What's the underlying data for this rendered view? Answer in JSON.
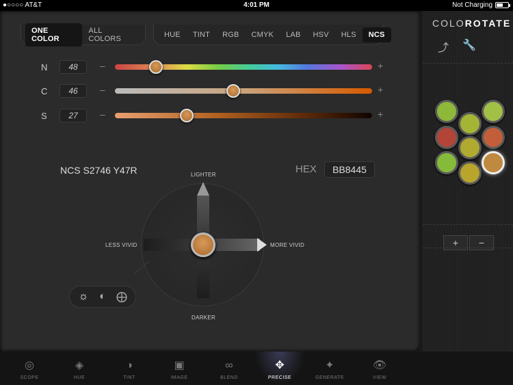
{
  "status": {
    "carrier": "●○○○○ AT&T",
    "wifi_icon": "wifi-icon",
    "time": "4:01 PM",
    "battery_text": "Not Charging",
    "battery_level": 0.55
  },
  "mode_tabs": [
    "ONE COLOR",
    "ALL COLORS"
  ],
  "space_tabs": [
    "HUE",
    "TINT",
    "RGB",
    "CMYK",
    "LAB",
    "HSV",
    "HLS",
    "NCS"
  ],
  "active_space": "NCS",
  "sliders": [
    {
      "label": "N",
      "value": "48",
      "minus": "–",
      "plus": "+",
      "position": 0.16
    },
    {
      "label": "C",
      "value": "46",
      "minus": "–",
      "plus": "+",
      "position": 0.46
    },
    {
      "label": "S",
      "value": "27",
      "minus": "–",
      "plus": "+",
      "position": 0.28
    }
  ],
  "ncs_code": "NCS S2746 Y47R",
  "hex": {
    "label": "HEX",
    "value": "BB8445"
  },
  "directions": {
    "up": "LIGHTER",
    "down": "DARKER",
    "left": "LESS VIVID",
    "right": "MORE VIVID"
  },
  "mode_toggle": [
    "sun-icon",
    "contrast-icon",
    "arrows-icon"
  ],
  "brand": {
    "pre": "COLO",
    "post": "ROTATE"
  },
  "swatches": [
    "#8db83a",
    "#a4b536",
    "#a2c046",
    "#b24438",
    "#b0ab30",
    "#c25f3a",
    "#86bb3a",
    "#b9a52c",
    "#bf8a3f"
  ],
  "selected_swatch": 8,
  "palette_buttons": {
    "add": "+",
    "remove": "−"
  },
  "toolbar": [
    {
      "label": "SCOPE",
      "icon": "scope-icon"
    },
    {
      "label": "HUE",
      "icon": "hue-icon"
    },
    {
      "label": "TINT",
      "icon": "tint-icon"
    },
    {
      "label": "IMAGE",
      "icon": "image-icon"
    },
    {
      "label": "BLEND",
      "icon": "blend-icon"
    },
    {
      "label": "PRECISE",
      "icon": "precise-icon"
    },
    {
      "label": "GENERATE",
      "icon": "generate-icon"
    },
    {
      "label": "VIEW",
      "icon": "view-icon"
    }
  ],
  "active_tool": "PRECISE"
}
